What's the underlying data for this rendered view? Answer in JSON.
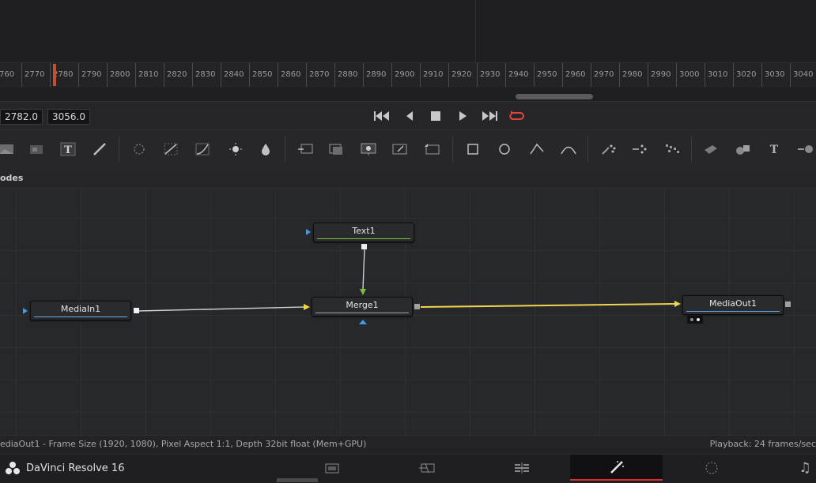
{
  "timeline": {
    "ticks": [
      "760",
      "2770",
      "2780",
      "2790",
      "2800",
      "2810",
      "2820",
      "2830",
      "2840",
      "2850",
      "2860",
      "2870",
      "2880",
      "2890",
      "2900",
      "2910",
      "2920",
      "2930",
      "2940",
      "2950",
      "2960",
      "2970",
      "2980",
      "2990",
      "3000",
      "3010",
      "3020",
      "3030",
      "3040"
    ]
  },
  "transport": {
    "start_time": "2782.0",
    "end_time": "3056.0",
    "buttons": [
      "skip-to-start",
      "step-back",
      "stop",
      "play",
      "skip-to-end",
      "loop"
    ],
    "loop_color": "#e0453a"
  },
  "toolbar": {
    "tools": [
      "background",
      "image-plane",
      "text",
      "paint",
      "particles",
      "color-curves",
      "brightness-contrast",
      "color-corrector",
      "blur",
      "loader",
      "saver",
      "merge",
      "transform",
      "crop-transform",
      "rectangle-mask",
      "ellipse-mask",
      "polygon-mask",
      "bspline-mask",
      "particle-emitter",
      "particle-render",
      "pixel-particles",
      "3d-shape",
      "3d-merge",
      "3d-text",
      "3d-render"
    ]
  },
  "nodes_panel": {
    "title": "odes",
    "nodes": [
      {
        "id": "text1",
        "label": "Text1",
        "bar_color": "#7bbf3a"
      },
      {
        "id": "mediain1",
        "label": "MediaIn1",
        "bar_color": "#6aa7de"
      },
      {
        "id": "merge1",
        "label": "Merge1",
        "bar_color": "#a0a0a0"
      },
      {
        "id": "mediaout1",
        "label": "MediaOut1",
        "bar_color": "#6aa7de"
      }
    ],
    "link_color_main": "#f2d44a",
    "link_color_input": "#cfcfcf"
  },
  "status": {
    "left": "ediaOut1 - Frame Size (1920, 1080), Pixel Aspect 1:1, Depth 32bit float (Mem+GPU)",
    "right": "Playback: 24 frames/sec"
  },
  "pagebar": {
    "app_name": "DaVinci Resolve 16",
    "pages": [
      "media",
      "cut",
      "edit",
      "fusion",
      "color",
      "fairlight"
    ],
    "active_page": "fusion",
    "accent": "#d8332f"
  }
}
